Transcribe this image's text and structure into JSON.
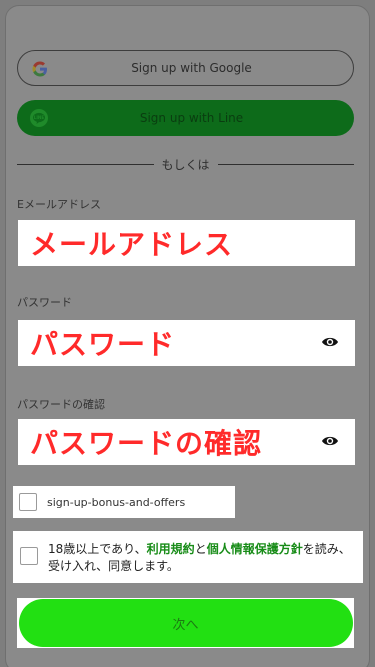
{
  "social": {
    "google_label": "Sign up with Google",
    "line_label": "Sign up with Line"
  },
  "divider_text": "もしくは",
  "email": {
    "label": "Eメールアドレス",
    "annotation": "メールアドレス"
  },
  "password": {
    "label": "パスワード",
    "annotation": "パスワード"
  },
  "confirm_password": {
    "label": "パスワードの確認",
    "annotation": "パスワードの確認"
  },
  "bonus_offer": {
    "label": "sign-up-bonus-and-offers"
  },
  "terms": {
    "prefix": "18歳以上であり、",
    "link1": "利用規約",
    "middle": "と",
    "link2": "個人情報保護方針",
    "suffix": "を読み、受け入れ、同意します。"
  },
  "next_button": "次へ",
  "colors": {
    "line_green": "#0d6b1a",
    "next_green": "#22e012",
    "annotation_red": "#ff2a2a",
    "link_green": "#188c18"
  }
}
